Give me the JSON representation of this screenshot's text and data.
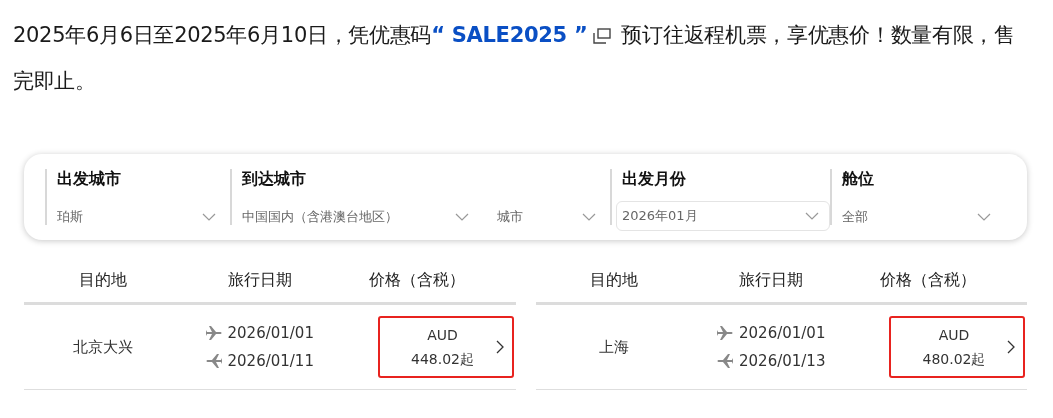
{
  "promo": {
    "before": "2025年6月6日至2025年6月10日，凭优惠码",
    "open_quote": "“",
    "code": "SALE2025",
    "close_quote": "”",
    "after": "预订往返程机票，享优惠价！数量有限，售完即止。"
  },
  "filters": [
    {
      "label": "出发城市",
      "selects": [
        {
          "value": "珀斯",
          "kind": "plain"
        }
      ]
    },
    {
      "label": "到达城市",
      "selects": [
        {
          "value": "中国国内（含港澳台地区）",
          "kind": "plain"
        },
        {
          "value": "城市",
          "kind": "plain"
        }
      ]
    },
    {
      "label": "出发月份",
      "selects": [
        {
          "value": "2026年01月",
          "kind": "boxed"
        }
      ]
    },
    {
      "label": "舱位",
      "selects": [
        {
          "value": "全部",
          "kind": "plain"
        }
      ]
    }
  ],
  "tables": [
    {
      "columns": [
        "目的地",
        "旅行日期",
        "价格（含税）"
      ],
      "rows": [
        {
          "destination": "北京大兴",
          "outbound": "2026/01/01",
          "return": "2026/01/11",
          "currency": "AUD",
          "price": "448.02起"
        }
      ]
    },
    {
      "columns": [
        "目的地",
        "旅行日期",
        "价格（含税）"
      ],
      "rows": [
        {
          "destination": "上海",
          "outbound": "2026/01/01",
          "return": "2026/01/13",
          "currency": "AUD",
          "price": "480.02起"
        }
      ]
    }
  ]
}
